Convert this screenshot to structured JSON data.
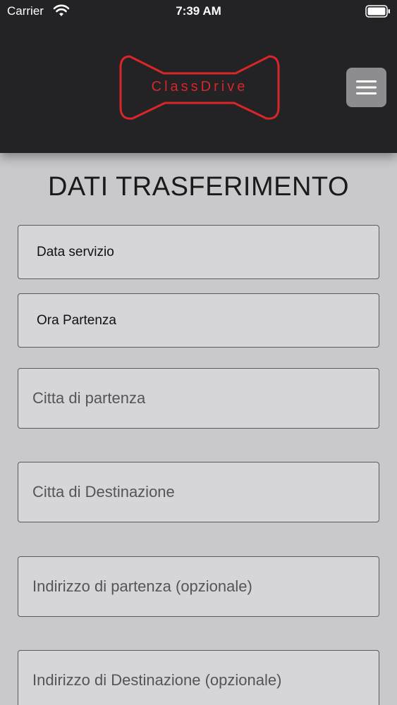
{
  "status_bar": {
    "carrier": "Carrier",
    "time": "7:39 AM"
  },
  "header": {
    "logo_text": "ClassDrive",
    "logo_color": "#d8262a",
    "menu_icon": "hamburger-icon"
  },
  "page_title": "DATI TRASFERIMENTO",
  "fields": [
    {
      "label": "Data servizio"
    },
    {
      "label": "Ora Partenza"
    },
    {
      "placeholder": "Citta di partenza"
    },
    {
      "placeholder": "Citta di Destinazione"
    },
    {
      "placeholder": "Indirizzo di partenza (opzionale)"
    },
    {
      "placeholder": "Indirizzo di Destinazione (opzionale)"
    }
  ]
}
